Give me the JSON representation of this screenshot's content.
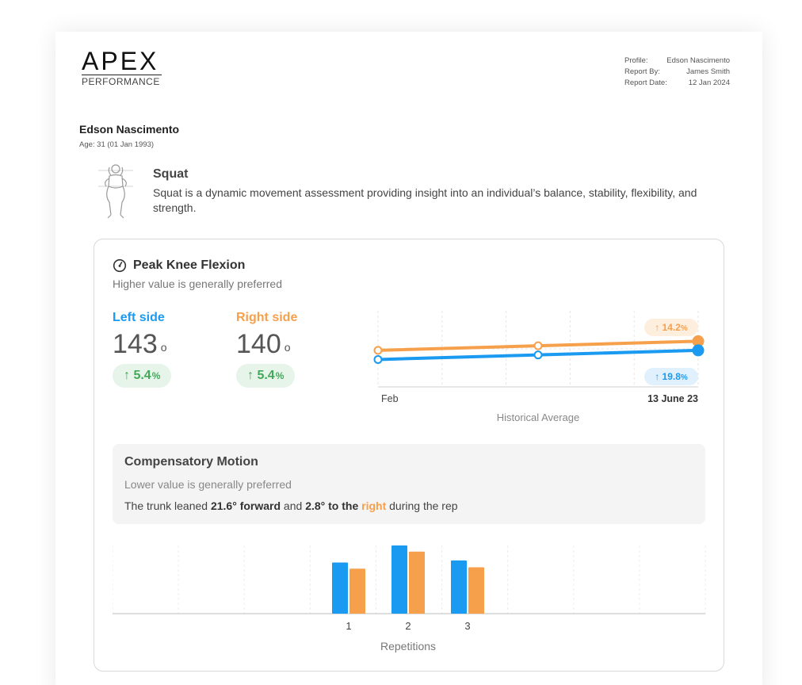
{
  "brand": {
    "name": "APEX",
    "tagline": "PERFORMANCE"
  },
  "meta": {
    "profile_label": "Profile:",
    "profile_value": "Edson Nascimento",
    "report_by_label": "Report By:",
    "report_by_value": "James Smith",
    "report_date_label": "Report Date:",
    "report_date_value": "12 Jan 2024"
  },
  "athlete": {
    "name": "Edson Nascimento",
    "age": "Age: 31 (01 Jan 1993)"
  },
  "test": {
    "title": "Squat",
    "description": "Squat is a dynamic movement assessment providing insight into an individual’s balance, stability, flexibility, and strength."
  },
  "metric": {
    "title": "Peak Knee Flexion",
    "subtitle": "Higher value is generally preferred",
    "left": {
      "label": "Left side",
      "value": "143",
      "unit": "o",
      "change": "5.4",
      "change_unit": "%"
    },
    "right": {
      "label": "Right side",
      "value": "140",
      "unit": "o",
      "change": "5.4",
      "change_unit": "%"
    }
  },
  "colors": {
    "left": "#1a9af0",
    "right": "#f7a04b",
    "positive": "#43a85a",
    "positive_bg": "#e6f4ea"
  },
  "chart_data": [
    {
      "type": "line",
      "xlabel": "Historical Average",
      "x_start_label": "Feb",
      "x_end_label": "13 June 23",
      "series": [
        {
          "name": "Right side",
          "values": [
            137,
            138.5,
            140
          ],
          "change_label": "14.2",
          "change_unit": "%"
        },
        {
          "name": "Left side",
          "values": [
            134,
            135.5,
            137
          ],
          "change_label": "19.8",
          "change_unit": "%"
        }
      ],
      "ylim": [
        125,
        150
      ],
      "grid": true
    },
    {
      "type": "bar",
      "xlabel": "Repetitions",
      "categories": [
        "1",
        "2",
        "3"
      ],
      "series": [
        {
          "name": "Left side",
          "values": [
            75,
            100,
            78
          ]
        },
        {
          "name": "Right side",
          "values": [
            66,
            91,
            68
          ]
        }
      ],
      "ylim": [
        0,
        100
      ],
      "grid": true
    }
  ],
  "compensatory": {
    "title": "Compensatory Motion",
    "subtitle": "Lower value is generally preferred",
    "text_1": "The trunk leaned ",
    "forward_value": "21.6° forward",
    "text_2": " and ",
    "side_value": "2.8° to the",
    "side_dir": "right",
    "text_3": " during the rep"
  }
}
